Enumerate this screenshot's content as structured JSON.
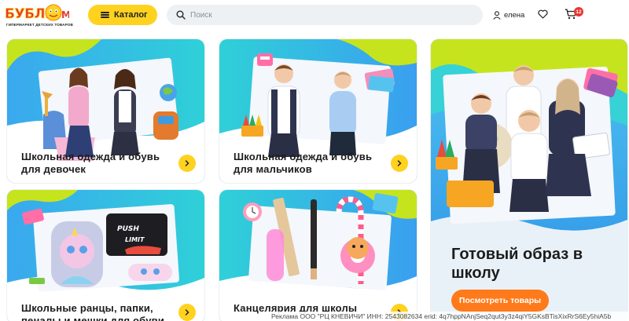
{
  "header": {
    "logo_text": "БУБЛЬ ГУМ",
    "logo_tagline": "ГИПЕРМАРКЕТ ДЕТСКИХ ТОВАРОВ",
    "catalog_label": "Каталог",
    "search_placeholder": "Поиск",
    "user_name": "елена",
    "cart_count": "12"
  },
  "cards": [
    {
      "title_line1": "Школьная одежда и обувь",
      "title_line2": "для девочек"
    },
    {
      "title_line1": "Школьная одежда и обувь",
      "title_line2": "для мальчиков"
    },
    {
      "title_line1": "Школьные ранцы, папки,",
      "title_line2": "пеналы и мешки для обуви"
    },
    {
      "title_line1": "Канцелярия для школы",
      "title_line2": ""
    }
  ],
  "hero": {
    "title_line1": "Готовый образ в",
    "title_line2": "школу",
    "button_label": "Посмотреть товары"
  },
  "ad_note": "Реклама ООО \"РЦ КНЕВИЧИ\" ИНН: 2543082634 erid: 4q7hppNAnjSeq2qut3y3z4qiY5GKsBTisXixRrS6Ey5hiA5b",
  "colors": {
    "accent_yellow": "#ffd21f",
    "hero_button": "#ff7a1a",
    "badge_red": "#e8352f",
    "banner_blue": "#2f8fe6",
    "banner_teal": "#33c7d6",
    "banner_lime": "#c4e51c"
  },
  "icons": {
    "catalog": "menu-icon",
    "search": "search-icon",
    "user": "user-icon",
    "favorites": "heart-icon",
    "cart": "cart-icon",
    "card_arrow": "chevron-right-icon"
  }
}
